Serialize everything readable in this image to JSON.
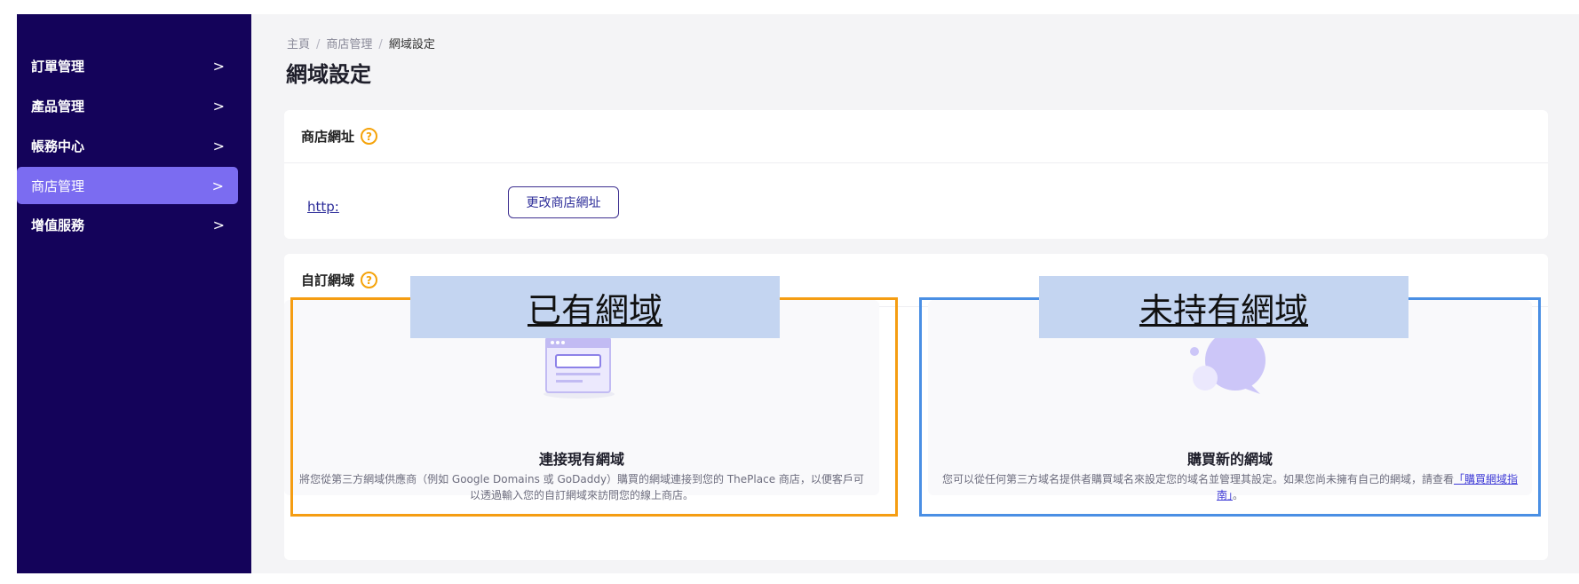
{
  "sidebar": {
    "items": [
      {
        "label": "訂單管理",
        "chevron": ">"
      },
      {
        "label": "產品管理",
        "chevron": ">"
      },
      {
        "label": "帳務中心",
        "chevron": ">"
      },
      {
        "label": "商店管理",
        "chevron": ">",
        "active": true
      },
      {
        "label": "增值服務",
        "chevron": ">"
      }
    ]
  },
  "breadcrumb": {
    "home": "主頁",
    "parent": "商店管理",
    "current": "網域設定",
    "separator": "/"
  },
  "page": {
    "title": "網域設定"
  },
  "store_url_card": {
    "title": "商店網址",
    "help_icon": "?",
    "url_text": "http:",
    "change_button": "更改商店網址"
  },
  "custom_domain_card": {
    "title": "自訂網域",
    "help_icon": "?",
    "options": [
      {
        "banner": "已有網域",
        "title": "連接現有網域",
        "desc": "將您從第三方網域供應商（例如 Google Domains 或 GoDaddy）購買的網域連接到您的 ThePlace 商店，以便客戶可以透過輸入您的自訂網域來訪問您的線上商店。"
      },
      {
        "banner": "未持有網域",
        "title": "購買新的網域",
        "desc": "您可以從任何第三方域名提供者購買域名來設定您的域名並管理其設定。如果您尚未擁有自己的網域，請查看",
        "link": "「購買網域指南」",
        "desc_end": "。"
      }
    ]
  },
  "colors": {
    "sidebar_bg": "#14035a",
    "active_item": "#7b6cf1",
    "frame_orange": "#f59d12",
    "frame_blue": "#4a8fe4",
    "banner_bg": "#c4d5f1"
  }
}
